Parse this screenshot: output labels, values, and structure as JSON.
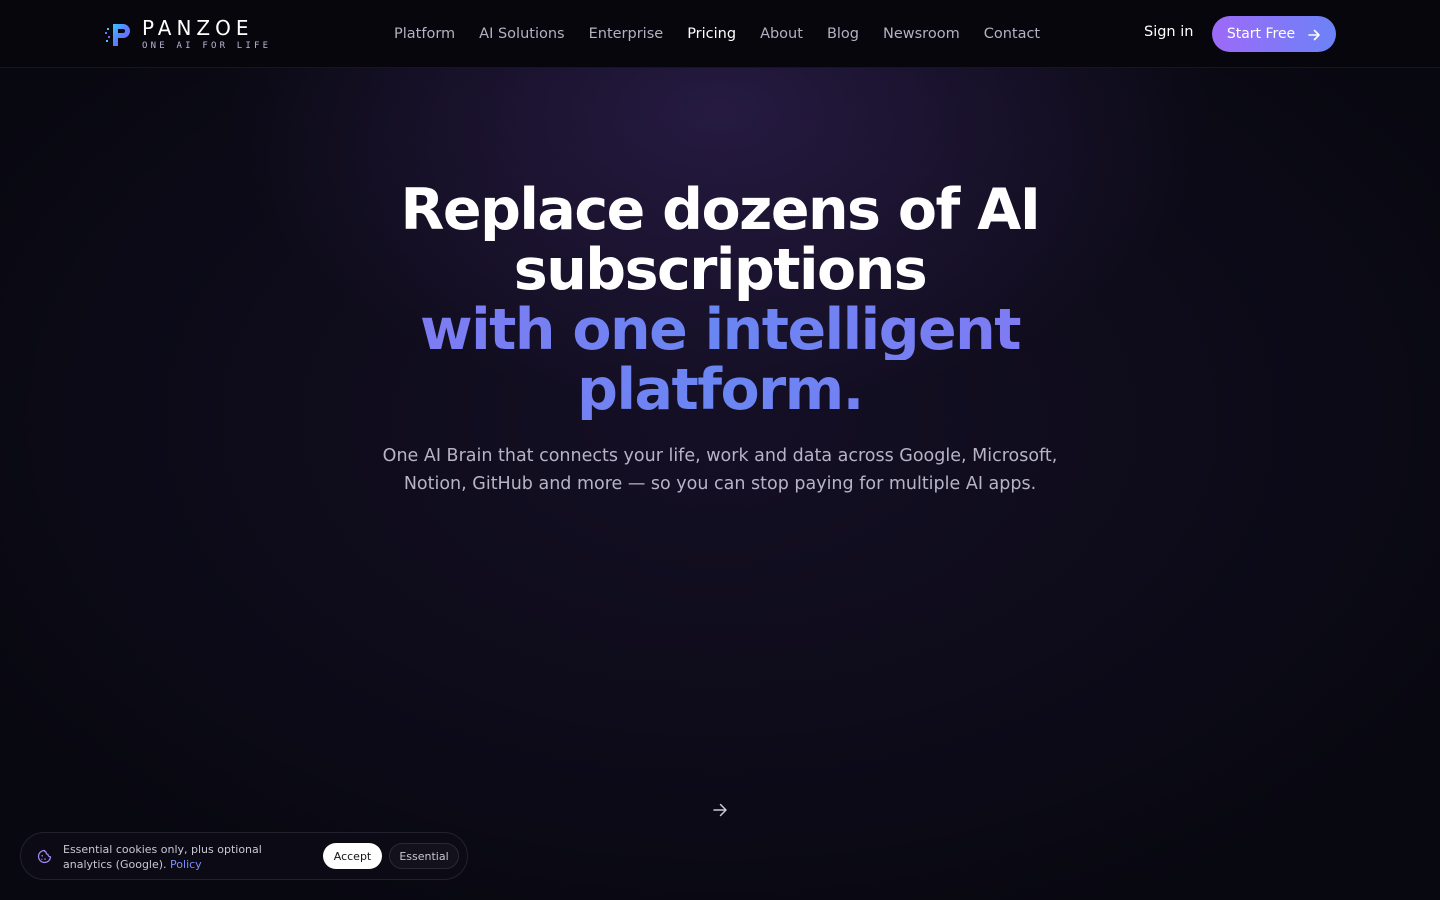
{
  "brand": {
    "name": "PANZOE",
    "tagline": "ONE AI FOR LIFE",
    "logo_icon": "panzoe-p-logo-icon",
    "accent_colors": [
      "#9d6af7",
      "#6c82f7"
    ]
  },
  "nav": {
    "items": [
      {
        "label": "Platform",
        "active": false
      },
      {
        "label": "AI Solutions",
        "active": false
      },
      {
        "label": "Enterprise",
        "active": false
      },
      {
        "label": "Pricing",
        "active": true
      },
      {
        "label": "About",
        "active": false
      },
      {
        "label": "Blog",
        "active": false
      },
      {
        "label": "Newsroom",
        "active": false
      },
      {
        "label": "Contact",
        "active": false
      }
    ]
  },
  "header": {
    "signin_label": "Sign in",
    "start_label": "Start Free",
    "start_icon": "arrow-right-icon"
  },
  "hero": {
    "title_line1": "Replace dozens of AI",
    "title_line2": "subscriptions",
    "title_line3": "with one intelligent",
    "title_line4": "platform.",
    "subtitle": "One AI Brain that connects your life, work and data across Google, Microsoft, Notion, GitHub and more — so you can stop paying for multiple AI apps.",
    "scroll_icon": "arrow-right-icon"
  },
  "cookie": {
    "icon": "cookie-icon",
    "text": "Essential cookies only, plus optional analytics (Google).",
    "policy_label": "Policy",
    "accept_label": "Accept",
    "essential_label": "Essential"
  }
}
